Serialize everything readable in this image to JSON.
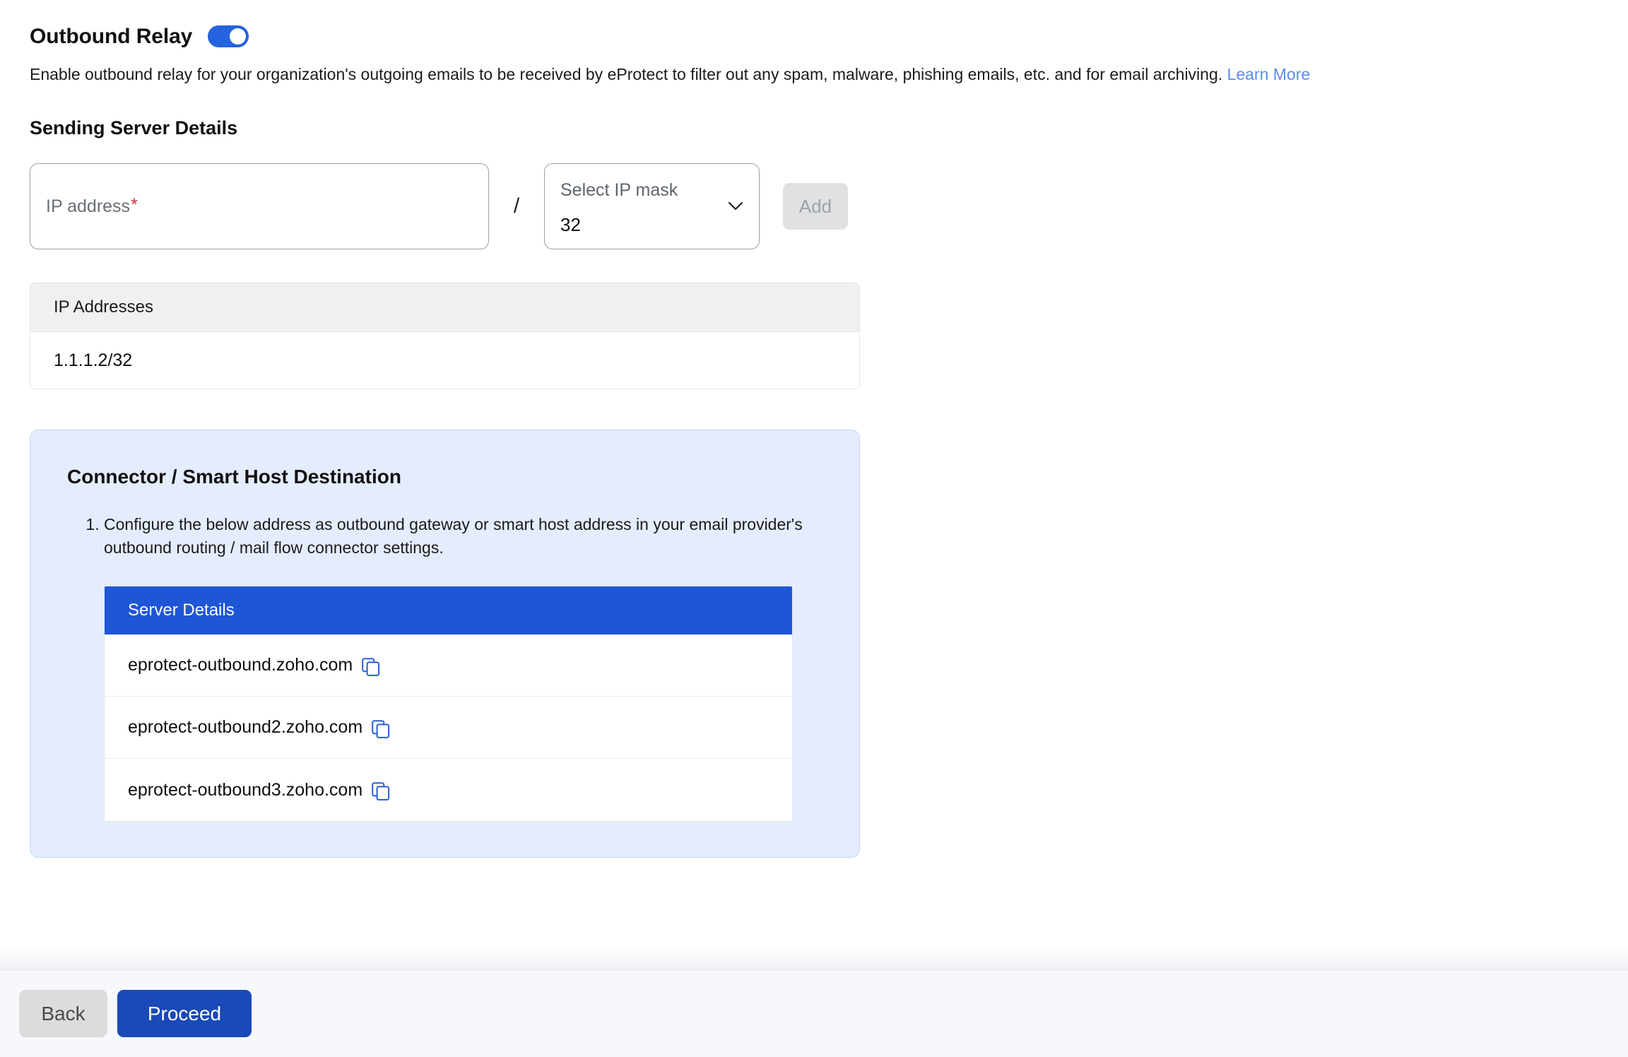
{
  "header": {
    "title": "Outbound Relay",
    "toggle_state": "on",
    "toggle_color": "#2563e0"
  },
  "description": {
    "text": "Enable outbound relay for your organization's outgoing emails to be received by eProtect to filter out any spam, malware, phishing emails, etc. and for email archiving.",
    "link_label": "Learn More",
    "link_color": "#5b8def"
  },
  "sending_server": {
    "section_title": "Sending Server Details",
    "ip_input": {
      "placeholder": "IP address",
      "required_marker": "*",
      "value": ""
    },
    "separator": "/",
    "mask_select": {
      "label": "Select IP mask",
      "value": "32",
      "chevron_icon": "chevron-down-icon"
    },
    "add_button": {
      "label": "Add",
      "disabled": true
    }
  },
  "ip_table": {
    "header": "IP Addresses",
    "rows": [
      "1.1.1.2/32"
    ]
  },
  "connector_panel": {
    "title": "Connector / Smart Host Destination",
    "steps": [
      "Configure the below address as outbound gateway or smart host address in your email provider's outbound routing / mail flow connector settings."
    ],
    "server_table": {
      "header": "Server Details",
      "header_color": "#1e56d6",
      "rows": [
        {
          "host": "eprotect-outbound.zoho.com",
          "copy_icon": "copy-icon"
        },
        {
          "host": "eprotect-outbound2.zoho.com",
          "copy_icon": "copy-icon"
        },
        {
          "host": "eprotect-outbound3.zoho.com",
          "copy_icon": "copy-icon"
        }
      ]
    }
  },
  "footer": {
    "back_label": "Back",
    "proceed_label": "Proceed",
    "proceed_color": "#1a49b8"
  }
}
